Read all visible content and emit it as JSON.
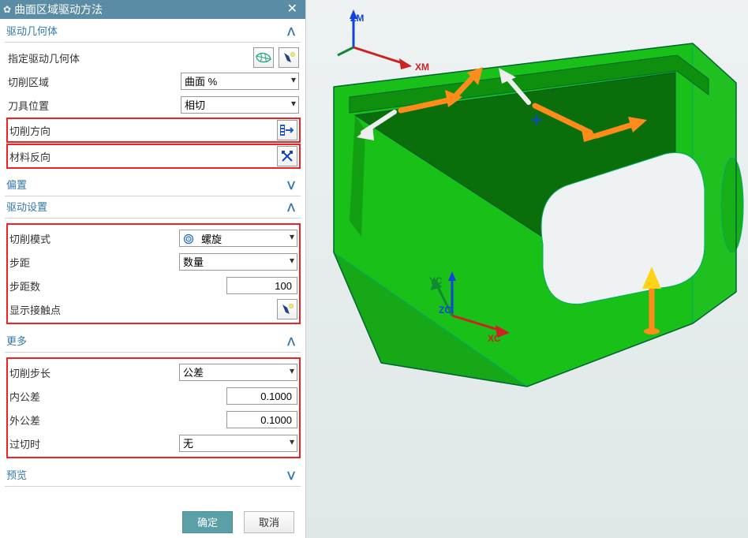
{
  "dialog": {
    "title": "曲面区域驱动方法",
    "sections": {
      "drive_geom": {
        "header": "驱动几何体",
        "specify": "指定驱动几何体",
        "cut_region_label": "切削区域",
        "cut_region_value": "曲面 %",
        "tool_pos_label": "刀具位置",
        "tool_pos_value": "相切",
        "cut_dir": "切削方向",
        "mat_reverse": "材料反向"
      },
      "offset": {
        "header": "偏置"
      },
      "drive_set": {
        "header": "驱动设置",
        "cut_mode_label": "切削模式",
        "cut_mode_value": "螺旋",
        "step_label": "步距",
        "step_value": "数量",
        "step_num_label": "步距数",
        "step_num_value": "100",
        "contact_label": "显示接触点"
      },
      "more": {
        "header": "更多",
        "cut_step_label": "切削步长",
        "cut_step_value": "公差",
        "in_tol_label": "内公差",
        "in_tol_value": "0.1000",
        "out_tol_label": "外公差",
        "out_tol_value": "0.1000",
        "overcut_label": "过切时",
        "overcut_value": "无"
      },
      "preview": {
        "header": "预览"
      }
    },
    "buttons": {
      "ok": "确定",
      "cancel": "取消"
    }
  },
  "viewport": {
    "axes_top": {
      "zm": "ZM",
      "xm": "XM"
    },
    "axes_bot": {
      "yc": "YC",
      "zc": "ZC",
      "xc": "XC"
    }
  }
}
